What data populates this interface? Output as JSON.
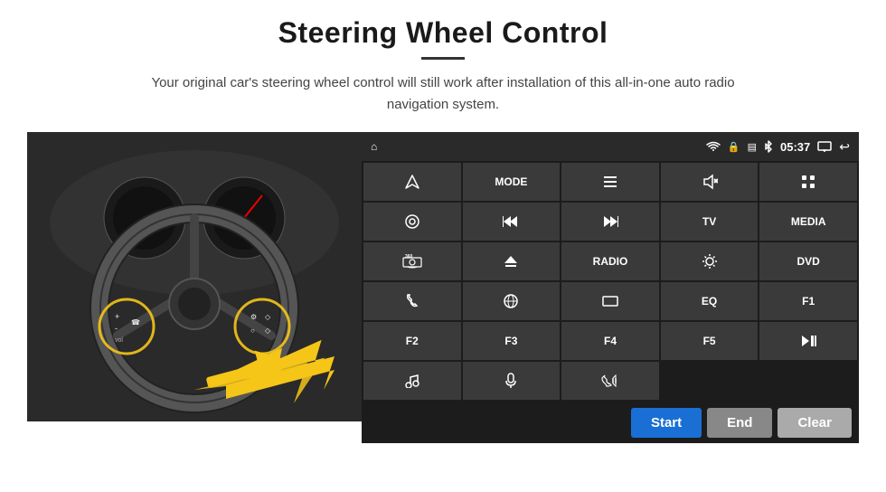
{
  "page": {
    "title": "Steering Wheel Control",
    "subtitle": "Your original car's steering wheel control will still work after installation of this all-in-one auto radio navigation system.",
    "divider": true
  },
  "statusBar": {
    "homeIcon": "⌂",
    "wifiIcon": "wifi",
    "lockIcon": "🔒",
    "simIcon": "📶",
    "btIcon": "bluetooth",
    "time": "05:37",
    "screenIcon": "screen",
    "backIcon": "↩"
  },
  "buttons": [
    {
      "label": "",
      "icon": "navigate",
      "type": "icon",
      "row": 1
    },
    {
      "label": "MODE",
      "icon": "",
      "type": "text",
      "row": 1
    },
    {
      "label": "",
      "icon": "list",
      "type": "icon",
      "row": 1
    },
    {
      "label": "",
      "icon": "mute",
      "type": "icon",
      "row": 1
    },
    {
      "label": "",
      "icon": "apps",
      "type": "icon",
      "row": 1
    },
    {
      "label": "",
      "icon": "settings-circle",
      "type": "icon",
      "row": 2
    },
    {
      "label": "",
      "icon": "prev",
      "type": "icon",
      "row": 2
    },
    {
      "label": "",
      "icon": "next",
      "type": "icon",
      "row": 2
    },
    {
      "label": "TV",
      "icon": "",
      "type": "text",
      "row": 2
    },
    {
      "label": "MEDIA",
      "icon": "",
      "type": "text",
      "row": 2
    },
    {
      "label": "",
      "icon": "360cam",
      "type": "icon",
      "row": 3
    },
    {
      "label": "",
      "icon": "eject",
      "type": "icon",
      "row": 3
    },
    {
      "label": "RADIO",
      "icon": "",
      "type": "text",
      "row": 3
    },
    {
      "label": "",
      "icon": "brightness",
      "type": "icon",
      "row": 3
    },
    {
      "label": "DVD",
      "icon": "",
      "type": "text",
      "row": 3
    },
    {
      "label": "",
      "icon": "phone",
      "type": "icon",
      "row": 4
    },
    {
      "label": "",
      "icon": "globe",
      "type": "icon",
      "row": 4
    },
    {
      "label": "",
      "icon": "rectangle",
      "type": "icon",
      "row": 4
    },
    {
      "label": "EQ",
      "icon": "",
      "type": "text",
      "row": 4
    },
    {
      "label": "F1",
      "icon": "",
      "type": "text",
      "row": 4
    },
    {
      "label": "F2",
      "icon": "",
      "type": "text",
      "row": 5
    },
    {
      "label": "F3",
      "icon": "",
      "type": "text",
      "row": 5
    },
    {
      "label": "F4",
      "icon": "",
      "type": "text",
      "row": 5
    },
    {
      "label": "F5",
      "icon": "",
      "type": "text",
      "row": 5
    },
    {
      "label": "",
      "icon": "play-pause",
      "type": "icon",
      "row": 5
    },
    {
      "label": "",
      "icon": "music",
      "type": "icon",
      "row": 6
    },
    {
      "label": "",
      "icon": "mic",
      "type": "icon",
      "row": 6
    },
    {
      "label": "",
      "icon": "phone-call",
      "type": "icon",
      "row": 6
    }
  ],
  "actionBar": {
    "startLabel": "Start",
    "endLabel": "End",
    "clearLabel": "Clear"
  }
}
